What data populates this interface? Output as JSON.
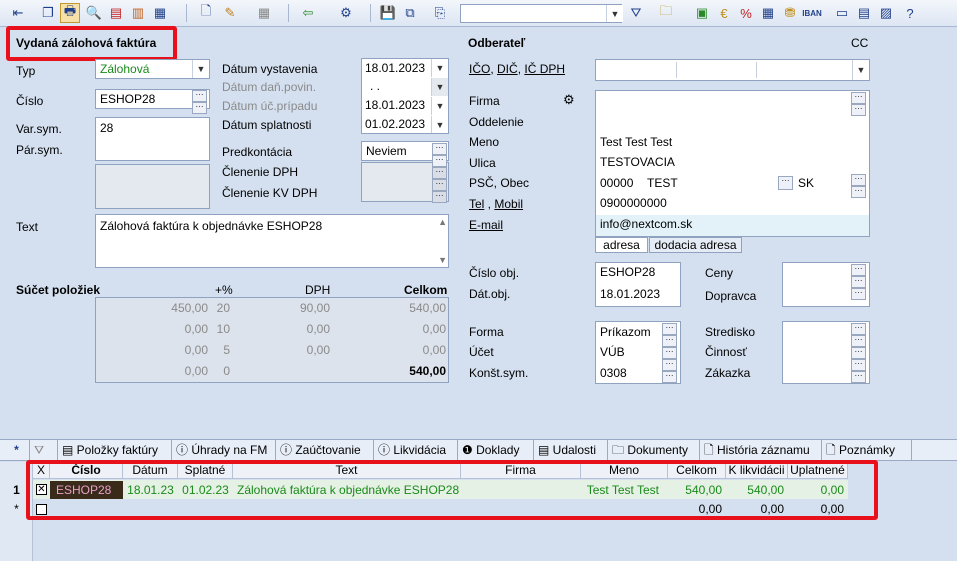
{
  "header": {
    "doc_type": "Vydaná zálohová faktúra",
    "odberatel_title": "Odberateľ",
    "cc": "CC"
  },
  "left": {
    "typ_label": "Typ",
    "typ_value": "Zálohová",
    "cislo_label": "Číslo",
    "cislo_value": "ESHOP28",
    "varsym_label": "Var.sym.",
    "varsym_value": "28",
    "parsym_label": "Pár.sym.",
    "text_label": "Text",
    "text_value": "Zálohová faktúra k objednávke ESHOP28"
  },
  "dates": {
    "vystavenia_label": "Dátum vystavenia",
    "vystavenia_value": "18.01.2023",
    "danpovin_label": "Dátum daň.povin.",
    "danpovin_value": ". .",
    "ucpripadu_label": "Dátum úč.prípadu",
    "ucpripadu_value": "18.01.2023",
    "splatnosti_label": "Dátum splatnosti",
    "splatnosti_value": "01.02.2023",
    "predkontacia_label": "Predkontácia",
    "predkontacia_value": "Neviem",
    "clenenie_dph_label": "Členenie DPH",
    "clenenie_kv_label": "Členenie KV DPH"
  },
  "sums": {
    "title": "Súčet položiek",
    "col_pct": "+%",
    "col_dph": "DPH",
    "col_celkom": "Celkom",
    "rows": [
      {
        "base": "450,00",
        "pct": "20",
        "dph": "90,00",
        "celkom": "540,00"
      },
      {
        "base": "0,00",
        "pct": "10",
        "dph": "0,00",
        "celkom": "0,00"
      },
      {
        "base": "0,00",
        "pct": "5",
        "dph": "0,00",
        "celkom": "0,00"
      },
      {
        "base": "0,00",
        "pct": "0",
        "dph": "",
        "celkom": "540,00"
      }
    ]
  },
  "odberatel": {
    "ico": "IČO",
    "dic": "DIČ",
    "icdph": "IČ DPH",
    "firma_label": "Firma",
    "oddelenie_label": "Oddelenie",
    "meno_label": "Meno",
    "meno_value": "Test Test Test",
    "ulica_label": "Ulica",
    "ulica_value": "TESTOVACIA",
    "psc_label": "PSČ, Obec",
    "psc_value": "00000",
    "obec_value": "TEST",
    "country_value": "SK",
    "tel_label": "Tel",
    "mobil_label": "Mobil",
    "tel_value": "0900000000",
    "email_label": "E-mail",
    "email_value": "info@nextcom.sk",
    "tab_adresa": "adresa",
    "tab_dodacia": "dodacia adresa"
  },
  "order": {
    "cisloobj_label": "Číslo obj.",
    "cisloobj_value": "ESHOP28",
    "datobj_label": "Dát.obj.",
    "datobj_value": "18.01.2023",
    "ceny_label": "Ceny",
    "dopravca_label": "Dopravca",
    "forma_label": "Forma",
    "forma_value": "Príkazom",
    "ucet_label": "Účet",
    "ucet_value": "VÚB",
    "konst_label": "Konšt.sym.",
    "konst_value": "0308",
    "stredisko_label": "Stredisko",
    "cinnost_label": "Činnosť",
    "zakazka_label": "Zákazka"
  },
  "tabs": [
    "*",
    "Položky faktúry",
    "Úhrady na FM",
    "Zaúčtovanie",
    "Likvidácia",
    "Doklady",
    "Udalosti",
    "Dokumenty",
    "História záznamu",
    "Poznámky"
  ],
  "grid": {
    "headers": [
      "X",
      "Číslo",
      "Dátum",
      "Splatné",
      "Text",
      "Firma",
      "Meno",
      "Celkom",
      "K likvidácii",
      "Uplatnené"
    ],
    "row1": {
      "num": "1",
      "cislo": "ESHOP28",
      "datum": "18.01.23",
      "splatne": "01.02.23",
      "text": "Zálohová faktúra k objednávke ESHOP28",
      "firma": "",
      "meno": "Test Test Test",
      "celkom": "540,00",
      "klikv": "540,00",
      "uplatnene": "0,00"
    },
    "row2": {
      "marker": "*",
      "celkom": "0,00",
      "klikv": "0,00",
      "uplatnene": "0,00"
    }
  },
  "colors": {
    "green": "#1a8a1a",
    "highlight": "#e8101a",
    "selected_cell": "#3a2a1a"
  }
}
